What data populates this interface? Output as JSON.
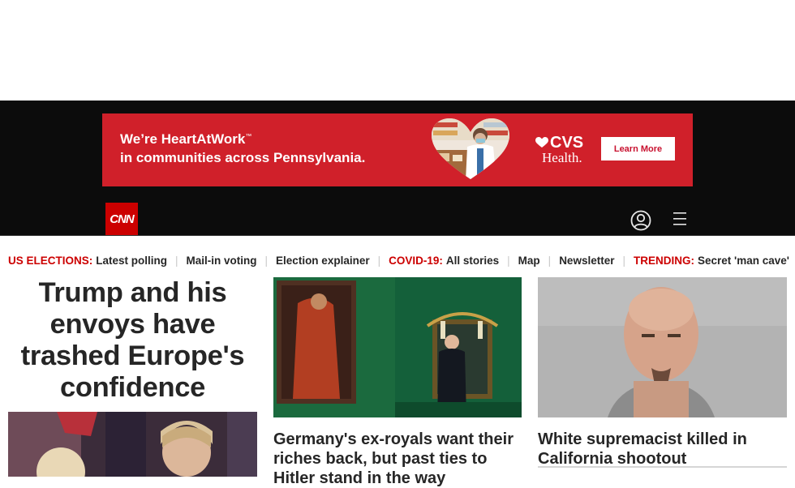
{
  "ad": {
    "line1_prefix": "We’re",
    "line1_brand": "HeartAtWork",
    "line1_tm": "™",
    "line2": "in communities across Pennsylvania.",
    "logo_top": "CVS",
    "logo_bottom": "Health.",
    "cta_label": "Learn More",
    "colors": {
      "banner_bg": "#d0202a",
      "cta_text": "#c8102e"
    }
  },
  "nav": {
    "logo_text": "CNN",
    "user_icon": "user-icon",
    "menu_icon": "menu-icon",
    "colors": {
      "bar_bg": "#0c0c0c",
      "logo_bg": "#cc0000"
    }
  },
  "trending": {
    "us_elections_label": "US ELECTIONS:",
    "latest_polling": "Latest polling",
    "mail_in_voting": "Mail-in voting",
    "election_explainer": "Election explainer",
    "covid_label": "COVID-19:",
    "all_stories": "All stories",
    "map": "Map",
    "newsletter": "Newsletter",
    "trending_label": "TRENDING:",
    "trending_item": "Secret 'man cave'",
    "separator": "|"
  },
  "stories": {
    "lead_headline": "Trump and his envoys have trashed Europe's confidence",
    "story2_title": "Germany's ex-royals want their riches back, but past ties to Hitler stand in the way",
    "story3_title": "White supremacist killed in California shootout"
  }
}
